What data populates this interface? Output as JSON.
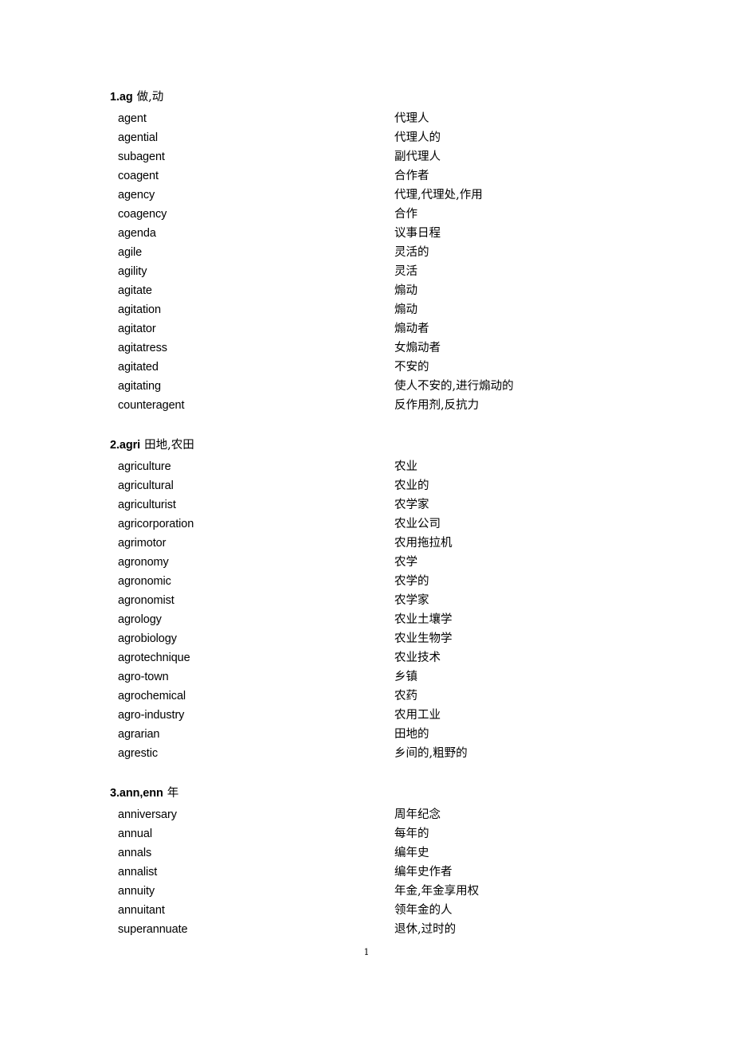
{
  "document": {
    "page_number": "1",
    "background_color": "#ffffff",
    "text_color": "#000000"
  },
  "sections": [
    {
      "heading_root": "1.ag",
      "heading_gloss": "做,动",
      "entries": [
        {
          "word": "agent",
          "meaning": "代理人"
        },
        {
          "word": "agential",
          "meaning": "代理人的"
        },
        {
          "word": "subagent",
          "meaning": "副代理人"
        },
        {
          "word": "coagent",
          "meaning": "合作者"
        },
        {
          "word": "agency",
          "meaning": "代理,代理处,作用"
        },
        {
          "word": "coagency",
          "meaning": "合作"
        },
        {
          "word": "agenda",
          "meaning": "议事日程"
        },
        {
          "word": "agile",
          "meaning": "灵活的"
        },
        {
          "word": "agility",
          "meaning": "灵活"
        },
        {
          "word": "agitate",
          "meaning": "煽动"
        },
        {
          "word": "agitation",
          "meaning": "煽动"
        },
        {
          "word": "agitator",
          "meaning": "煽动者"
        },
        {
          "word": "agitatress",
          "meaning": "女煽动者"
        },
        {
          "word": "agitated",
          "meaning": "不安的"
        },
        {
          "word": "agitating",
          "meaning": "使人不安的,进行煽动的"
        },
        {
          "word": "counteragent",
          "meaning": "反作用剂,反抗力"
        }
      ]
    },
    {
      "heading_root": "2.agri",
      "heading_gloss": "田地,农田",
      "entries": [
        {
          "word": "agriculture",
          "meaning": "农业"
        },
        {
          "word": "agricultural",
          "meaning": "农业的"
        },
        {
          "word": "agriculturist",
          "meaning": "农学家"
        },
        {
          "word": "agricorporation",
          "meaning": "农业公司"
        },
        {
          "word": "agrimotor",
          "meaning": "农用拖拉机"
        },
        {
          "word": "agronomy",
          "meaning": "农学"
        },
        {
          "word": "agronomic",
          "meaning": "农学的"
        },
        {
          "word": "agronomist",
          "meaning": "农学家"
        },
        {
          "word": "agrology",
          "meaning": "农业土壤学"
        },
        {
          "word": "agrobiology",
          "meaning": "农业生物学"
        },
        {
          "word": "agrotechnique",
          "meaning": "农业技术"
        },
        {
          "word": "agro-town",
          "meaning": "乡镇"
        },
        {
          "word": "agrochemical",
          "meaning": "农药"
        },
        {
          "word": "agro-industry",
          "meaning": "农用工业"
        },
        {
          "word": "agrarian",
          "meaning": "田地的"
        },
        {
          "word": "agrestic",
          "meaning": "乡间的,粗野的"
        }
      ]
    },
    {
      "heading_root": "3.ann,enn",
      "heading_gloss": "年",
      "entries": [
        {
          "word": "anniversary",
          "meaning": "周年纪念"
        },
        {
          "word": "annual",
          "meaning": "每年的"
        },
        {
          "word": "annals",
          "meaning": "编年史"
        },
        {
          "word": "annalist",
          "meaning": "编年史作者"
        },
        {
          "word": "annuity",
          "meaning": "年金,年金享用权"
        },
        {
          "word": "annuitant",
          "meaning": "领年金的人"
        },
        {
          "word": "superannuate",
          "meaning": "退休,过时的"
        }
      ]
    }
  ]
}
